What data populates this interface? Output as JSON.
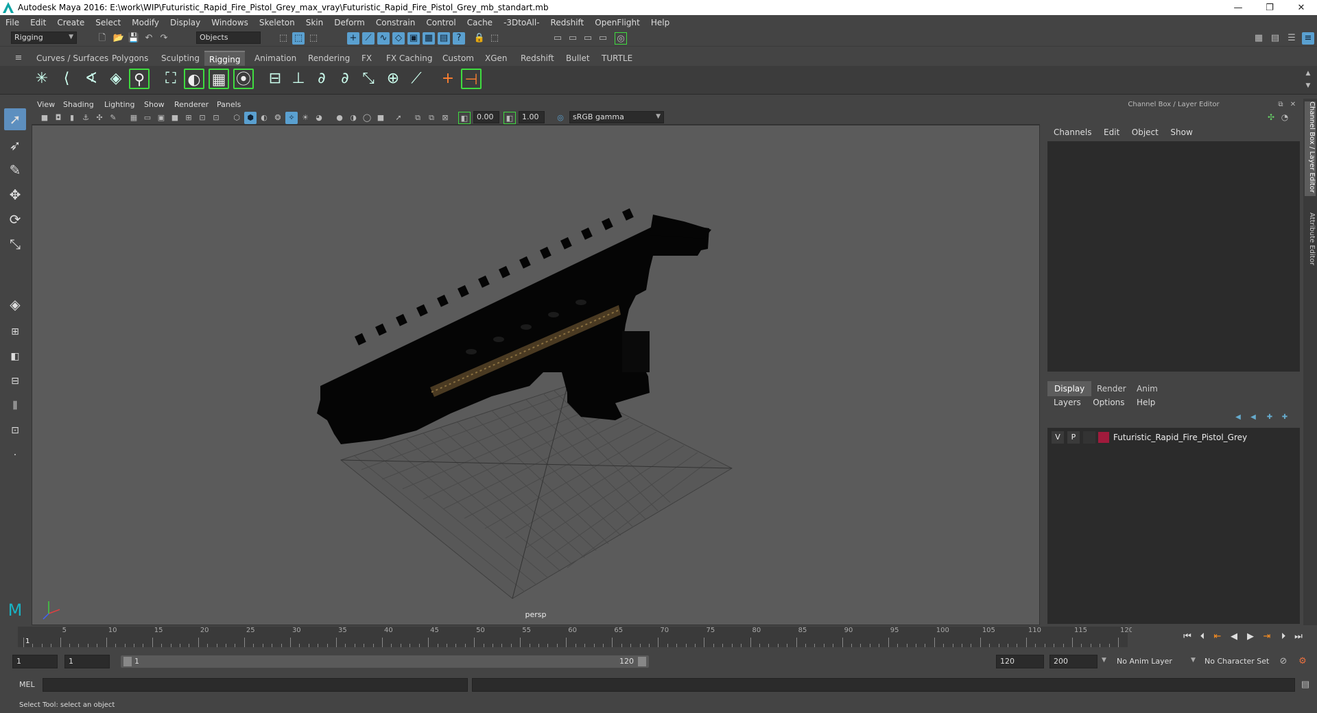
{
  "window": {
    "title": "Autodesk Maya 2016: E:\\work\\WIP\\Futuristic_Rapid_Fire_Pistol_Grey_max_vray\\Futuristic_Rapid_Fire_Pistol_Grey_mb_standart.mb",
    "minimize": "—",
    "restore": "❐",
    "close": "✕"
  },
  "menubar": [
    "File",
    "Edit",
    "Create",
    "Select",
    "Modify",
    "Display",
    "Windows",
    "Skeleton",
    "Skin",
    "Deform",
    "Constrain",
    "Control",
    "Cache",
    "-3DtoAll-",
    "Redshift",
    "OpenFlight",
    "Help"
  ],
  "statusline": {
    "menuset": "Rigging",
    "selection_mode": "Objects"
  },
  "shelf_tabs": [
    "Curves / Surfaces",
    "Polygons",
    "Sculpting",
    "Rigging",
    "Animation",
    "Rendering",
    "FX",
    "FX Caching",
    "Custom",
    "XGen",
    "Redshift",
    "Bullet",
    "TURTLE"
  ],
  "shelf_active": "Rigging",
  "viewport": {
    "menu": [
      "View",
      "Shading",
      "Lighting",
      "Show",
      "Renderer",
      "Panels"
    ],
    "exposure": "0.00",
    "gamma": "1.00",
    "color_space": "sRGB gamma",
    "camera_label": "persp"
  },
  "channel_box": {
    "header": "Channel Box / Layer Editor",
    "menu": [
      "Channels",
      "Edit",
      "Object",
      "Show"
    ]
  },
  "layer_editor": {
    "tabs": [
      "Display",
      "Render",
      "Anim"
    ],
    "active_tab": "Display",
    "menu": [
      "Layers",
      "Options",
      "Help"
    ],
    "layers": [
      {
        "v": "V",
        "p": "P",
        "name": "Futuristic_Rapid_Fire_Pistol_Grey",
        "color": "#a01b3c"
      }
    ]
  },
  "side_tabs": [
    "Channel Box / Layer Editor",
    "Attribute Editor"
  ],
  "timeline": {
    "ticks": [
      "1",
      "5",
      "10",
      "15",
      "20",
      "25",
      "30",
      "35",
      "40",
      "45",
      "50",
      "55",
      "60",
      "65",
      "70",
      "75",
      "80",
      "85",
      "90",
      "95",
      "100",
      "105",
      "110",
      "115",
      "120"
    ],
    "current_frame": "1"
  },
  "range": {
    "start": "1",
    "playback_start": "1",
    "slider_start": "1",
    "slider_end": "120",
    "playback_end": "120",
    "end": "200",
    "anim_layer": "No Anim Layer",
    "character_set": "No Character Set"
  },
  "command_line": {
    "label": "MEL"
  },
  "help_line": "Select Tool: select an object"
}
